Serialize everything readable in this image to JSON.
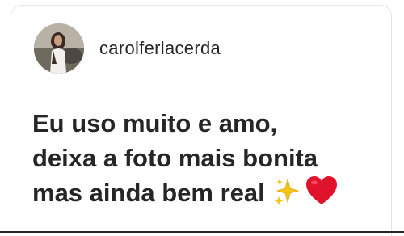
{
  "post": {
    "username": "carolferlacerda",
    "comment_lines": [
      "Eu uso muito e amo,",
      "deixa a foto mais bonita",
      "mas ainda bem real"
    ],
    "emojis": [
      "sparkles-icon",
      "heart-icon"
    ]
  },
  "colors": {
    "text": "#262626",
    "card_border": "#e4e4e4",
    "heart": "#e0122c",
    "sparkles": "#f5c518"
  }
}
